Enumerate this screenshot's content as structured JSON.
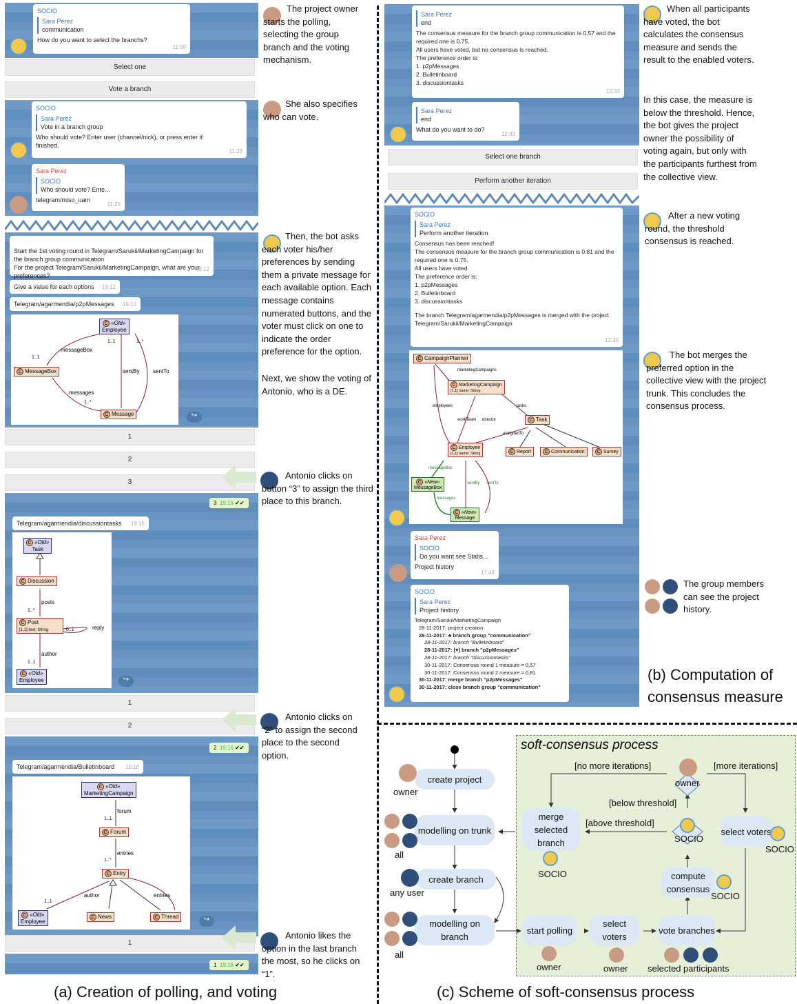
{
  "panel_a": {
    "caption": "(a) Creation of polling, and voting",
    "chat1": {
      "sender": "SOCIO",
      "quote_name": "Sara Perez",
      "quote_text": "communication",
      "message": "How do you want to select the branchs?",
      "time": "11:59"
    },
    "kb1": [
      "Select one",
      "Vote a branch"
    ],
    "chat2": {
      "sender": "SOCIO",
      "quote_name": "Sara Perez",
      "quote_text": "Vote in a branch group",
      "message": "Who should vote? Enter user (channel/nick), or press enter if finished.",
      "time": "11:23"
    },
    "chat3": {
      "sender": "Sara Perez",
      "quote_name": "SOCIO",
      "quote_text": "Who should vote? Ente...",
      "message": "telegram/miso_uam",
      "time": "11:25"
    },
    "chat4": {
      "message": "Start the 1st voting round in Telegram/Sarukii/MarketingCampaign for the branch group communication\nFor the project Telegram/Sarukii/MarketingCampaign, what are your preferences?",
      "time": "19:12"
    },
    "chat5": {
      "message": "Give a value for each options",
      "time": "19:12"
    },
    "chat6": {
      "message": "Telegram/agarmendia/p2pMessages",
      "time": "19:12"
    },
    "uml1": {
      "employee_stereo": "«Old»",
      "employee": "Employee",
      "messagebox": "MessageBox",
      "message": "Message",
      "l_messagebox": "messageBox",
      "l_11a": "1..1",
      "l_11b": "1..1",
      "l_1s": "1..*",
      "l_sentby": "sentBy",
      "l_sentto": "sentTo",
      "l_messages": "messages",
      "l_1s2": "1..*"
    },
    "kb2": [
      "1",
      "2",
      "3"
    ],
    "reply1": {
      "value": "3",
      "time": "19:15"
    },
    "chat7": {
      "message": "Telegram/agarmendia/discussiontasks",
      "time": "19:15"
    },
    "uml2": {
      "task_stereo": "«Old»",
      "task": "Task",
      "discussion": "Discussion",
      "post": "Post",
      "post_attr": "[1,1] text: String",
      "employee_stereo": "«Old»",
      "employee": "Employee",
      "l_posts": "posts",
      "l_1s": "1..*",
      "l_01": "0..1",
      "l_reply": "reply",
      "l_author": "author",
      "l_11": "1..1"
    },
    "kb3": [
      "1",
      "2"
    ],
    "reply2": {
      "value": "2",
      "time": "19:16"
    },
    "chat8": {
      "message": "Telegram/agarmendia/Bulletinboard",
      "time": "19:16"
    },
    "uml3": {
      "mc_stereo": "«Old»",
      "mc": "MarketingCampaign",
      "forum": "Forum",
      "entry": "Entry",
      "news": "News",
      "thread": "Thread",
      "emp_stereo": "«Old»",
      "employee": "Employee",
      "l_forum": "forum",
      "l_11": "1..1",
      "l_entries": "entries",
      "l_1s": "1..*",
      "l_author": "author",
      "l_11b": "1..1",
      "l_entries2": "entries"
    },
    "kb4": [
      "1"
    ],
    "reply3": {
      "value": "1",
      "time": "19:16"
    },
    "notes": [
      "The project owner starts the polling, selecting the group branch and the voting mechanism.",
      "She also specifies who can vote.",
      "Then, the bot asks each voter his/her preferences by sending them a private message for each available option. Each message contains numerated buttons, and the voter must click on one to indicate the order preference for the option.",
      "Next, we show the voting of Antonio, who is a DE.",
      "Antonio clicks on button “3” to assign the third place to this branch.",
      "Antonio clicks on “2” to assign the second place to the second option.",
      "Antonio likes the option in the last branch the most, so he clicks on “1”."
    ]
  },
  "panel_b": {
    "caption_l1": "(b) Computation of",
    "caption_l2": "consensus measure",
    "chat1": {
      "quote_name": "Sara Perez",
      "quote_text": "end",
      "lines": [
        "The consensus measure for the branch group communication is 0.57 and the required one is 0.75.",
        "All users have voted, but no consensus is reached.",
        "The preference order is:",
        "1. p2pMessages",
        "2. Bulletinboard",
        "3. discussiontasks"
      ],
      "time": "12:33"
    },
    "chat2": {
      "quote_name": "Sara Perez",
      "quote_text": "end",
      "message": "What do you want to do?",
      "time": "12:33"
    },
    "kb": [
      "Select one branch",
      "Perform another iteration"
    ],
    "chat3": {
      "sender": "SOCIO",
      "quote_name": "Sara Perez",
      "quote_text": "Perform another iteration",
      "lines": [
        "Consensus has been reached!",
        "The consensus measure for the branch group communication is 0.81 and the required one is 0.75.",
        "All users have voted.",
        "The preference order is:",
        "1. p2pMessages",
        "2. Bulletinboard",
        "3. discussiontasks",
        "",
        "The branch Telegram/agarmendia/p2pMessages is merged with the project Telegram/Sarukii/MarketingCampaign"
      ],
      "time": "12:35"
    },
    "uml": {
      "cp": "CampaignPlanner",
      "mc": "MarketingCampaign",
      "mc_attr": "[1,1] name: String",
      "task": "Task",
      "employee": "Employee",
      "emp_attr": "[1,1] name: String",
      "report": "Report",
      "comm": "Communication",
      "survey": "Survey",
      "mb_stereo": "«New»",
      "mb": "MessageBox",
      "msg_stereo": "«New»",
      "msg": "Message",
      "l_mcs": "marketingCampaigns",
      "l_emps": "employees",
      "l_team": "workTeam",
      "l_dir": "director",
      "l_tasks": "tasks",
      "l_assigned": "assignedTo",
      "l_mbox": "messageBox",
      "l_sentby": "sentBy",
      "l_sentto": "sentTo",
      "l_messages": "messages"
    },
    "chat4": {
      "sender": "Sara Perez",
      "quote_name": "SOCIO",
      "quote_text": "Do you want see Statis...",
      "message": "Project history",
      "time": "17:46"
    },
    "chat5": {
      "sender": "SOCIO",
      "quote_name": "Sara Perez",
      "quote_text": "Project history",
      "history": [
        "Telegram/Sarukii/MarketingCampaign",
        "28-11-2017: project creation",
        "28-11-2017: ♣ branch group \"communication\"",
        "28-11-2017: branch \"Bulletinboard\"",
        "28-11-2017: [♥] branch \"p2pMessages\"",
        "28-11-2017: branch \"discussiontasks\"",
        "30-11-2017: Consensus round 1 measure = 0,57",
        "30-11-2017: Consensus round 2 measure = 0,81",
        "30-11-2017: merge branch \"p2pMessages\"",
        "30-11-2017: close branch group \"communication\""
      ]
    },
    "notes": [
      "When all participants have voted, the bot calculates the consensus measure and sends the result to the enabled voters.",
      "In this case, the measure is below the threshold. Hence, the bot gives the project owner the possibility of voting again, but only with the participants furthest from the collective view.",
      "After a new voting round, the threshold consensus is reached.",
      "The bot merges the preferred option in the collective view with the project trunk. This concludes the consensus process.",
      "The group members can see the project history."
    ]
  },
  "panel_c": {
    "caption": "(c) Scheme of soft-consensus process",
    "box_title": "soft-consensus process",
    "nodes": {
      "create_project": "create project",
      "modelling_trunk": "modelling on trunk",
      "create_branch": "create branch",
      "modelling_branch": "modelling on branch",
      "start_polling": "start polling",
      "select_voters1": "select voters",
      "vote_branches": "vote branches",
      "compute": "compute consensus",
      "merge": "merge selected branch",
      "select_voters2": "select voters"
    },
    "labels": {
      "owner1": "owner",
      "all1": "all",
      "any_user": "any user",
      "all2": "all",
      "owner2": "owner",
      "owner3": "owner",
      "selected": "selected participants",
      "socio1": "SOCIO",
      "socio2": "SOCIO",
      "socio3": "SOCIO",
      "socio4": "SOCIO",
      "owner_dec": "owner",
      "no_more": "[no more iterations]",
      "more": "[more iterations]",
      "below": "[below threshold]",
      "above": "[above threshold]"
    }
  }
}
